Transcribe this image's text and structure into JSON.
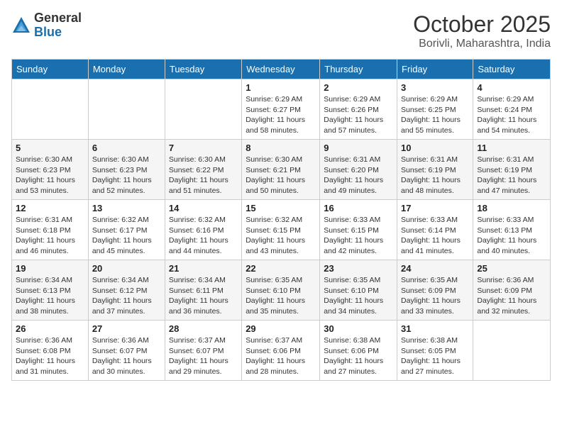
{
  "header": {
    "logo_general": "General",
    "logo_blue": "Blue",
    "month_title": "October 2025",
    "subtitle": "Borivli, Maharashtra, India"
  },
  "weekdays": [
    "Sunday",
    "Monday",
    "Tuesday",
    "Wednesday",
    "Thursday",
    "Friday",
    "Saturday"
  ],
  "weeks": [
    [
      {
        "day": "",
        "sunrise": "",
        "sunset": "",
        "daylight": ""
      },
      {
        "day": "",
        "sunrise": "",
        "sunset": "",
        "daylight": ""
      },
      {
        "day": "",
        "sunrise": "",
        "sunset": "",
        "daylight": ""
      },
      {
        "day": "1",
        "sunrise": "Sunrise: 6:29 AM",
        "sunset": "Sunset: 6:27 PM",
        "daylight": "Daylight: 11 hours and 58 minutes."
      },
      {
        "day": "2",
        "sunrise": "Sunrise: 6:29 AM",
        "sunset": "Sunset: 6:26 PM",
        "daylight": "Daylight: 11 hours and 57 minutes."
      },
      {
        "day": "3",
        "sunrise": "Sunrise: 6:29 AM",
        "sunset": "Sunset: 6:25 PM",
        "daylight": "Daylight: 11 hours and 55 minutes."
      },
      {
        "day": "4",
        "sunrise": "Sunrise: 6:29 AM",
        "sunset": "Sunset: 6:24 PM",
        "daylight": "Daylight: 11 hours and 54 minutes."
      }
    ],
    [
      {
        "day": "5",
        "sunrise": "Sunrise: 6:30 AM",
        "sunset": "Sunset: 6:23 PM",
        "daylight": "Daylight: 11 hours and 53 minutes."
      },
      {
        "day": "6",
        "sunrise": "Sunrise: 6:30 AM",
        "sunset": "Sunset: 6:23 PM",
        "daylight": "Daylight: 11 hours and 52 minutes."
      },
      {
        "day": "7",
        "sunrise": "Sunrise: 6:30 AM",
        "sunset": "Sunset: 6:22 PM",
        "daylight": "Daylight: 11 hours and 51 minutes."
      },
      {
        "day": "8",
        "sunrise": "Sunrise: 6:30 AM",
        "sunset": "Sunset: 6:21 PM",
        "daylight": "Daylight: 11 hours and 50 minutes."
      },
      {
        "day": "9",
        "sunrise": "Sunrise: 6:31 AM",
        "sunset": "Sunset: 6:20 PM",
        "daylight": "Daylight: 11 hours and 49 minutes."
      },
      {
        "day": "10",
        "sunrise": "Sunrise: 6:31 AM",
        "sunset": "Sunset: 6:19 PM",
        "daylight": "Daylight: 11 hours and 48 minutes."
      },
      {
        "day": "11",
        "sunrise": "Sunrise: 6:31 AM",
        "sunset": "Sunset: 6:19 PM",
        "daylight": "Daylight: 11 hours and 47 minutes."
      }
    ],
    [
      {
        "day": "12",
        "sunrise": "Sunrise: 6:31 AM",
        "sunset": "Sunset: 6:18 PM",
        "daylight": "Daylight: 11 hours and 46 minutes."
      },
      {
        "day": "13",
        "sunrise": "Sunrise: 6:32 AM",
        "sunset": "Sunset: 6:17 PM",
        "daylight": "Daylight: 11 hours and 45 minutes."
      },
      {
        "day": "14",
        "sunrise": "Sunrise: 6:32 AM",
        "sunset": "Sunset: 6:16 PM",
        "daylight": "Daylight: 11 hours and 44 minutes."
      },
      {
        "day": "15",
        "sunrise": "Sunrise: 6:32 AM",
        "sunset": "Sunset: 6:15 PM",
        "daylight": "Daylight: 11 hours and 43 minutes."
      },
      {
        "day": "16",
        "sunrise": "Sunrise: 6:33 AM",
        "sunset": "Sunset: 6:15 PM",
        "daylight": "Daylight: 11 hours and 42 minutes."
      },
      {
        "day": "17",
        "sunrise": "Sunrise: 6:33 AM",
        "sunset": "Sunset: 6:14 PM",
        "daylight": "Daylight: 11 hours and 41 minutes."
      },
      {
        "day": "18",
        "sunrise": "Sunrise: 6:33 AM",
        "sunset": "Sunset: 6:13 PM",
        "daylight": "Daylight: 11 hours and 40 minutes."
      }
    ],
    [
      {
        "day": "19",
        "sunrise": "Sunrise: 6:34 AM",
        "sunset": "Sunset: 6:13 PM",
        "daylight": "Daylight: 11 hours and 38 minutes."
      },
      {
        "day": "20",
        "sunrise": "Sunrise: 6:34 AM",
        "sunset": "Sunset: 6:12 PM",
        "daylight": "Daylight: 11 hours and 37 minutes."
      },
      {
        "day": "21",
        "sunrise": "Sunrise: 6:34 AM",
        "sunset": "Sunset: 6:11 PM",
        "daylight": "Daylight: 11 hours and 36 minutes."
      },
      {
        "day": "22",
        "sunrise": "Sunrise: 6:35 AM",
        "sunset": "Sunset: 6:10 PM",
        "daylight": "Daylight: 11 hours and 35 minutes."
      },
      {
        "day": "23",
        "sunrise": "Sunrise: 6:35 AM",
        "sunset": "Sunset: 6:10 PM",
        "daylight": "Daylight: 11 hours and 34 minutes."
      },
      {
        "day": "24",
        "sunrise": "Sunrise: 6:35 AM",
        "sunset": "Sunset: 6:09 PM",
        "daylight": "Daylight: 11 hours and 33 minutes."
      },
      {
        "day": "25",
        "sunrise": "Sunrise: 6:36 AM",
        "sunset": "Sunset: 6:09 PM",
        "daylight": "Daylight: 11 hours and 32 minutes."
      }
    ],
    [
      {
        "day": "26",
        "sunrise": "Sunrise: 6:36 AM",
        "sunset": "Sunset: 6:08 PM",
        "daylight": "Daylight: 11 hours and 31 minutes."
      },
      {
        "day": "27",
        "sunrise": "Sunrise: 6:36 AM",
        "sunset": "Sunset: 6:07 PM",
        "daylight": "Daylight: 11 hours and 30 minutes."
      },
      {
        "day": "28",
        "sunrise": "Sunrise: 6:37 AM",
        "sunset": "Sunset: 6:07 PM",
        "daylight": "Daylight: 11 hours and 29 minutes."
      },
      {
        "day": "29",
        "sunrise": "Sunrise: 6:37 AM",
        "sunset": "Sunset: 6:06 PM",
        "daylight": "Daylight: 11 hours and 28 minutes."
      },
      {
        "day": "30",
        "sunrise": "Sunrise: 6:38 AM",
        "sunset": "Sunset: 6:06 PM",
        "daylight": "Daylight: 11 hours and 27 minutes."
      },
      {
        "day": "31",
        "sunrise": "Sunrise: 6:38 AM",
        "sunset": "Sunset: 6:05 PM",
        "daylight": "Daylight: 11 hours and 27 minutes."
      },
      {
        "day": "",
        "sunrise": "",
        "sunset": "",
        "daylight": ""
      }
    ]
  ]
}
